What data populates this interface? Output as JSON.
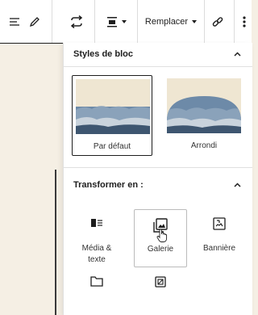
{
  "toolbar": {
    "replace_label": "Remplacer"
  },
  "styles_section": {
    "title": "Styles de bloc",
    "items": [
      {
        "label": "Par défaut",
        "selected": true
      },
      {
        "label": "Arrondi",
        "selected": false
      }
    ]
  },
  "transform_section": {
    "title": "Transformer en :",
    "items": [
      {
        "label_line1": "Média &",
        "label_line2": "texte"
      },
      {
        "label_line1": "Galerie",
        "label_line2": ""
      },
      {
        "label_line1": "Bannière",
        "label_line2": ""
      }
    ]
  },
  "colors": {
    "canvas": "#f5efe4",
    "text": "#1e1e1e",
    "sky": "#efe6d2",
    "clouds": "#5a7a96"
  }
}
